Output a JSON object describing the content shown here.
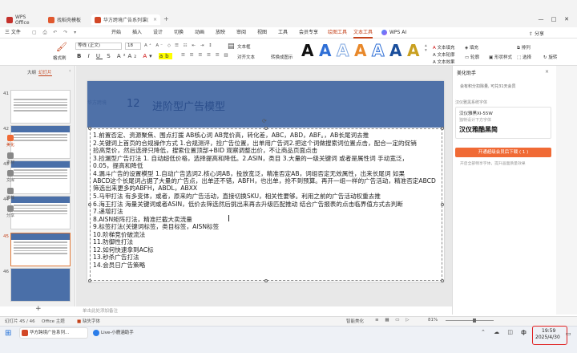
{
  "titlebar": {
    "tabs": [
      {
        "label": "WPS Office",
        "color": "#c4302b"
      },
      {
        "label": "找稻壳模板",
        "color": "#e0582e"
      },
      {
        "label": "华方跨境广告系列课(1).pptx",
        "color": "#d24726"
      }
    ],
    "window_controls": [
      "—",
      "□",
      "✕"
    ]
  },
  "menubar": {
    "file": "三 文件",
    "items": [
      "开始",
      "插入",
      "设计",
      "切换",
      "动画",
      "放映",
      "审阅",
      "视图",
      "工具",
      "会员专享",
      "绘图工具",
      "文本工具"
    ],
    "wps_ai": "WPS AI",
    "share": "分享"
  },
  "ribbon": {
    "format_painter": "格式刷",
    "font_name": "等线 (正文)",
    "font_size": "18",
    "text_box": "文本框",
    "align_text": "对齐文本",
    "convert": "转换成图示",
    "text_fill": "文本填充",
    "text_outline": "文本轮廓",
    "text_effect": "文本效果",
    "shape_fill": "填充",
    "shape_outline": "轮廓",
    "shape_style": "形状样式",
    "wordart_colors": [
      "#111111",
      "#2f6fd6",
      "#7fa7e0",
      "#e8882a",
      "#2f6fd6",
      "#1a4e9c",
      "#c9a020"
    ],
    "arrange": "排列",
    "select": "选择",
    "rotate": "旋转"
  },
  "leftpanel": {
    "tab_outline": "大纲",
    "tab_slides": "幻灯片",
    "slide_numbers": [
      "41",
      "42",
      "43",
      "44",
      "45",
      "46"
    ],
    "add_button": "+"
  },
  "slide": {
    "number": "12",
    "title": "进阶型广告模型",
    "logo": "华方跨境",
    "lines": [
      "1.前置否定、资源聚焦、围点打援    AB核心词 AB竞价高，转化差，ABC，ABD，ABF。，AB长尾词去推",
      "2.关键词上首页的合规操作方式 1.合规测评，捡广告位置，出单用广告词2.把这个词做搜索词位置点击，配合一定的促销",
      "      捡高竞价，然后选择只降低，搜索位置顶部+BID 观察调整出价，不让商品页面点击",
      "3.捡漏型广告打法 1. 自动超低价格，选择提高和降低。2.ASIN，类目 3.大量的一级关键词 或者是属性词 手动宽泛，",
      "0.05，提高和降低",
      "4.漏斗广告的设置模型 1.自动广告选词2.核心词AB，投放宽泛，精准否定AB，词组否定无效属性，出来长尾词 如果",
      "ABCD这个长尾词占据了大量的广告点，出单还不错，ABFH，也出单，抢不到预算。再开一组一样的广告活动，精准否定ABCD   筛选出来更多的ABFH，ABDL，ABXX",
      "5.马甲打法  有多变体，或者，原来的广告活动，直接切换SKU，相关性要够。利用之前的广告活动权重去推",
      "6.海王打法    海量关键词或者ASIN，低价去筛选然后挑出来再去升级匹配推动   结合广告报表的点击临界值方式去判断",
      "7.递增打法",
      "8.AISN矩阵打法，精准拦截大卖流量",
      "9.标签打法(关键词标签，类目标签，AISN标签",
      "10.阶梯竞价破流法",
      "11.防御性打法",
      "12.如何快速拿到AC标",
      "13.秒杀广告打法",
      "14.会员日广告策略"
    ]
  },
  "notes_placeholder": "单击此处添加备注",
  "rightpanel": {
    "title": "美化助手",
    "member_note": "会有积分扣除量, 可兑31天会员",
    "font_label": "汉仪雅黑系统字体",
    "font_name": "汉仪雅黑XI-55W",
    "font_desc": "独特设计下方字体",
    "font_preview": "汉仪雅酷黑简",
    "cta_button": "开通超级会员后下载 ( 1 )",
    "sub_link": "开启全部畅享字体，提升画面质量效果"
  },
  "sidebar": [
    "美化",
    "素材",
    "文库",
    "推荐",
    "分享"
  ],
  "statusbar": {
    "slide_position": "幻灯片 45 / 46",
    "theme": "Office 主题",
    "missing_font": "缺失字体",
    "smart_beautify": "智能美化",
    "zoom": "81%"
  },
  "taskbar": {
    "apps": [
      "华方跨境广告系列...",
      "Live-小鹿涵助手"
    ],
    "ime": "中",
    "time": "19:59",
    "date": "2025/4/30"
  }
}
